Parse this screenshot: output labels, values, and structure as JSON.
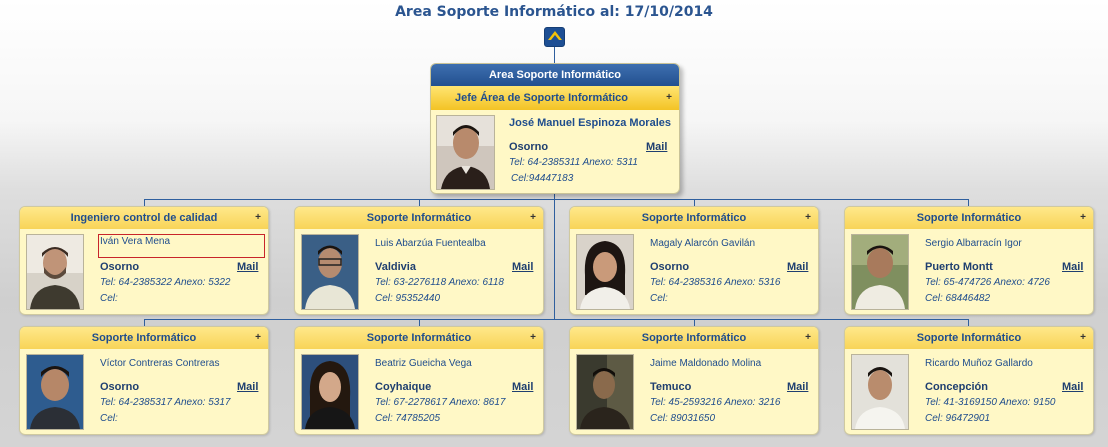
{
  "title": "Area Soporte Informático al: 17/10/2014",
  "top": {
    "area": "Area Soporte Informático",
    "role": "Jefe Área de Soporte Informático",
    "name": "José Manuel Espinoza Morales",
    "city": "Osorno",
    "mail": "Mail",
    "tel": "Tel: 64-2385311 Anexo: 5311",
    "cel": "Cel:94447183"
  },
  "cards": [
    {
      "role": "Ingeniero control de calidad",
      "name": "Iván Vera Mena",
      "city": "Osorno",
      "mail": "Mail",
      "tel": "Tel: 64-2385322   Anexo: 5322",
      "cel": "Cel:"
    },
    {
      "role": "Soporte Informático",
      "name": "Luis Abarzúa Fuentealba",
      "city": "Valdivia",
      "mail": "Mail",
      "tel": "Tel: 63-2276118 Anexo: 6118",
      "cel": "Cel: 95352440"
    },
    {
      "role": "Soporte Informático",
      "name": "Magaly Alarcón Gavilán",
      "city": "Osorno",
      "mail": "Mail",
      "tel": "Tel: 64-2385316 Anexo: 5316",
      "cel": "Cel:"
    },
    {
      "role": "Soporte Informático",
      "name": "Sergio Albarracín Igor",
      "city": "Puerto Montt",
      "mail": "Mail",
      "tel": "Tel: 65-474726 Anexo: 4726",
      "cel": "Cel: 68446482"
    },
    {
      "role": "Soporte Informático",
      "name": "Víctor Contreras Contreras",
      "city": "Osorno",
      "mail": "Mail",
      "tel": "Tel: 64-2385317  Anexo: 5317",
      "cel": "Cel:"
    },
    {
      "role": "Soporte Informático",
      "name": "Beatriz Gueicha Vega",
      "city": "Coyhaique",
      "mail": "Mail",
      "tel": "Tel: 67-2278617 Anexo: 8617",
      "cel": "Cel: 74785205"
    },
    {
      "role": "Soporte Informático",
      "name": "Jaime Maldonado Molina",
      "city": "Temuco",
      "mail": "Mail",
      "tel": "Tel: 45-2593216 Anexo: 3216",
      "cel": "Cel: 89031650"
    },
    {
      "role": "Soporte Informático",
      "name": "Ricardo Muñoz Gallardo",
      "city": "Concepción",
      "mail": "Mail",
      "tel": "Tel: 41-3169150 Anexo: 9150",
      "cel": "Cel: 96472901"
    }
  ],
  "plus": "+",
  "icons": {
    "up": "collapse-up-icon",
    "expand": "plus-icon"
  },
  "colors": {
    "blue_header": "#22508f",
    "yellow_header": "#f3c325",
    "card_bg": "#fff8c6",
    "text_blue": "#1f4d8d"
  }
}
